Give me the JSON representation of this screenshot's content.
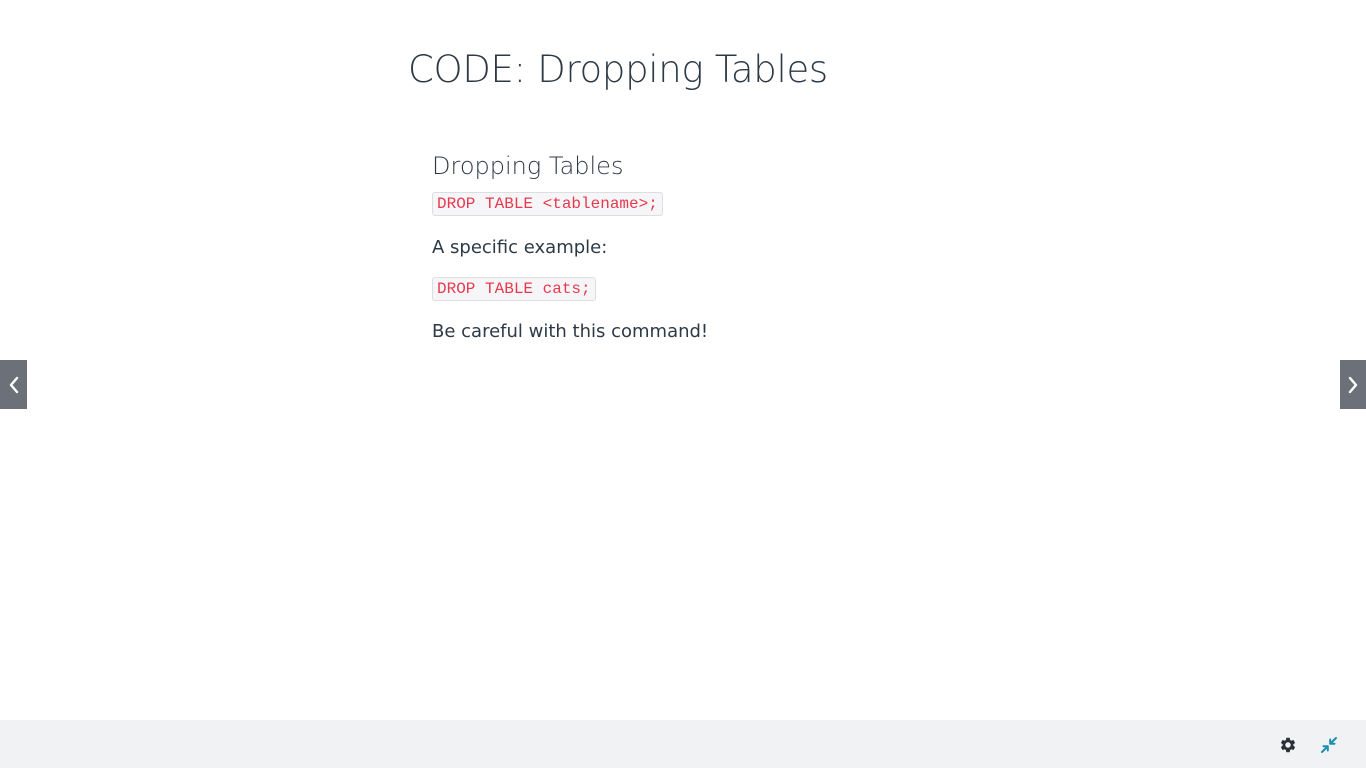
{
  "slide": {
    "title": "CODE: Dropping Tables",
    "section_heading": "Dropping Tables",
    "code_general": "DROP TABLE <tablename>;",
    "example_intro": "A specific example:",
    "code_example": "DROP TABLE cats;",
    "warning": "Be careful with this command!"
  },
  "navigation": {
    "prev_icon": "chevron-left-icon",
    "next_icon": "chevron-right-icon"
  },
  "footer": {
    "settings_icon": "gear-icon",
    "collapse_icon": "collapse-arrows-icon"
  },
  "colors": {
    "code_text": "#e8394f",
    "nav_background": "#6b7079",
    "collapse_accent": "#1a8fb0",
    "footer_background": "#f1f2f4"
  }
}
